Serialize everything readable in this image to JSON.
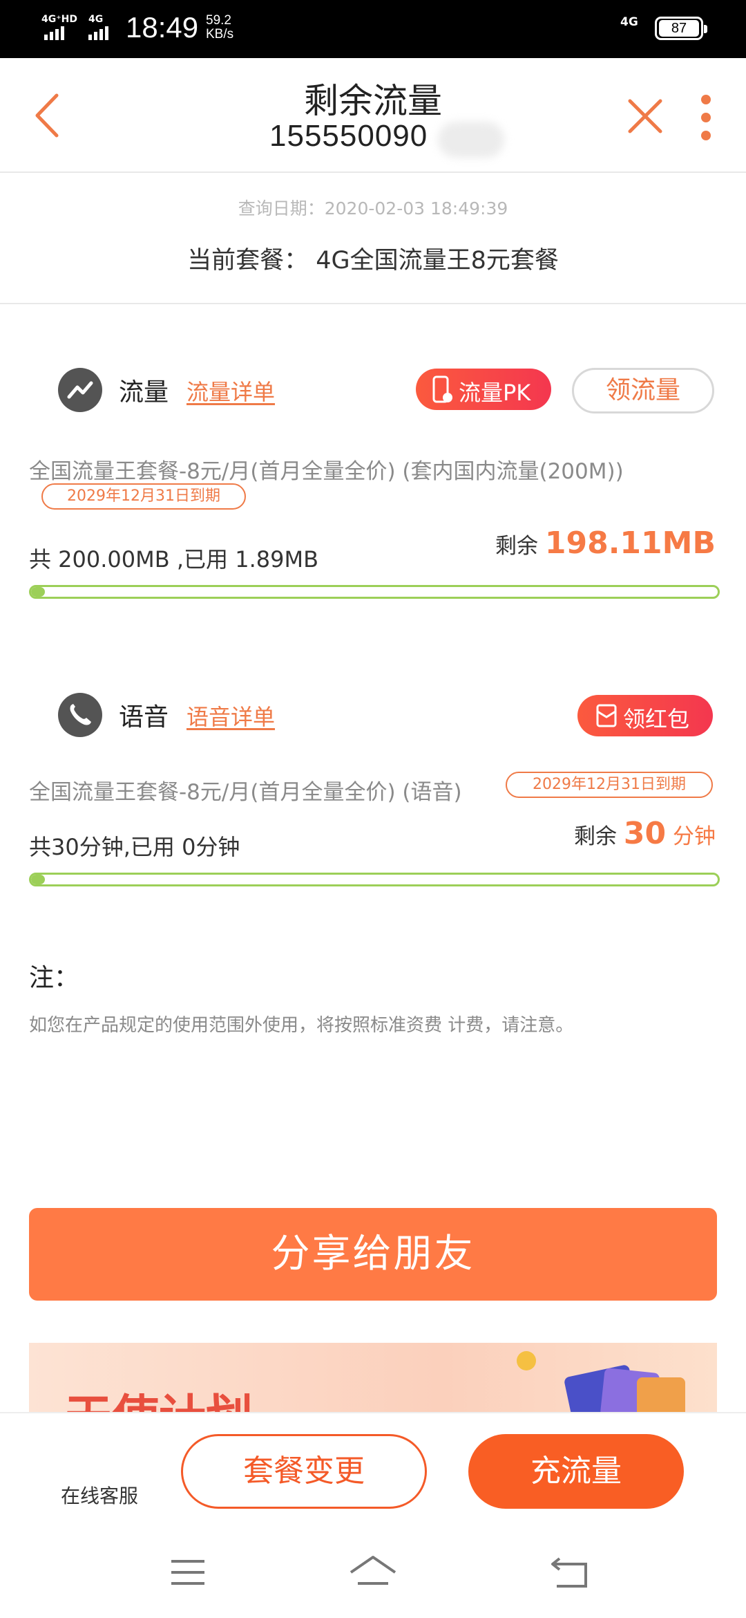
{
  "status_bar": {
    "signal1": "4G⁺HD",
    "signal2": "4G",
    "time": "18:49",
    "speed_value": "59.2",
    "speed_unit": "KB/s",
    "network": "4G",
    "battery": "87"
  },
  "header": {
    "title": "剩余流量",
    "phone": "155550090"
  },
  "info": {
    "query_date": "查询日期：2020-02-03 18:49:39",
    "current_plan": "当前套餐： 4G全国流量王8元套餐"
  },
  "data_section": {
    "title": "流量",
    "detail_link": "流量详单",
    "pk_button": "流量PK",
    "claim_button": "领流量",
    "package": "全国流量王套餐-8元/月(首月全量全价) (套内国内流量(200M))",
    "expire": "2029年12月31日到期",
    "usage": "共 200.00MB ,已用 1.89MB",
    "remain_label": "剩余",
    "remain_value": "198.11MB",
    "used_fraction": 0.0095
  },
  "voice_section": {
    "title": "语音",
    "detail_link": "语音详单",
    "red_packet_button": "领红包",
    "package": "全国流量王套餐-8元/月(首月全量全价) (语音)",
    "expire": "2029年12月31日到期",
    "usage": "共30分钟,已用 0分钟",
    "remain_label": "剩余",
    "remain_value": "30",
    "remain_unit": "分钟",
    "used_fraction": 0
  },
  "note": {
    "title": "注：",
    "text": "如您在产品规定的使用范围外使用，将按照标准资费 计费，请注意。"
  },
  "share_button": "分享给朋友",
  "banner_text": "天使计划",
  "bottom_bar": {
    "service_label": "在线客服",
    "change_plan": "套餐变更",
    "recharge": "充流量"
  },
  "colors": {
    "accent": "#ff7a45",
    "progress": "#9ccf58",
    "red_pill": "#f4374f"
  }
}
